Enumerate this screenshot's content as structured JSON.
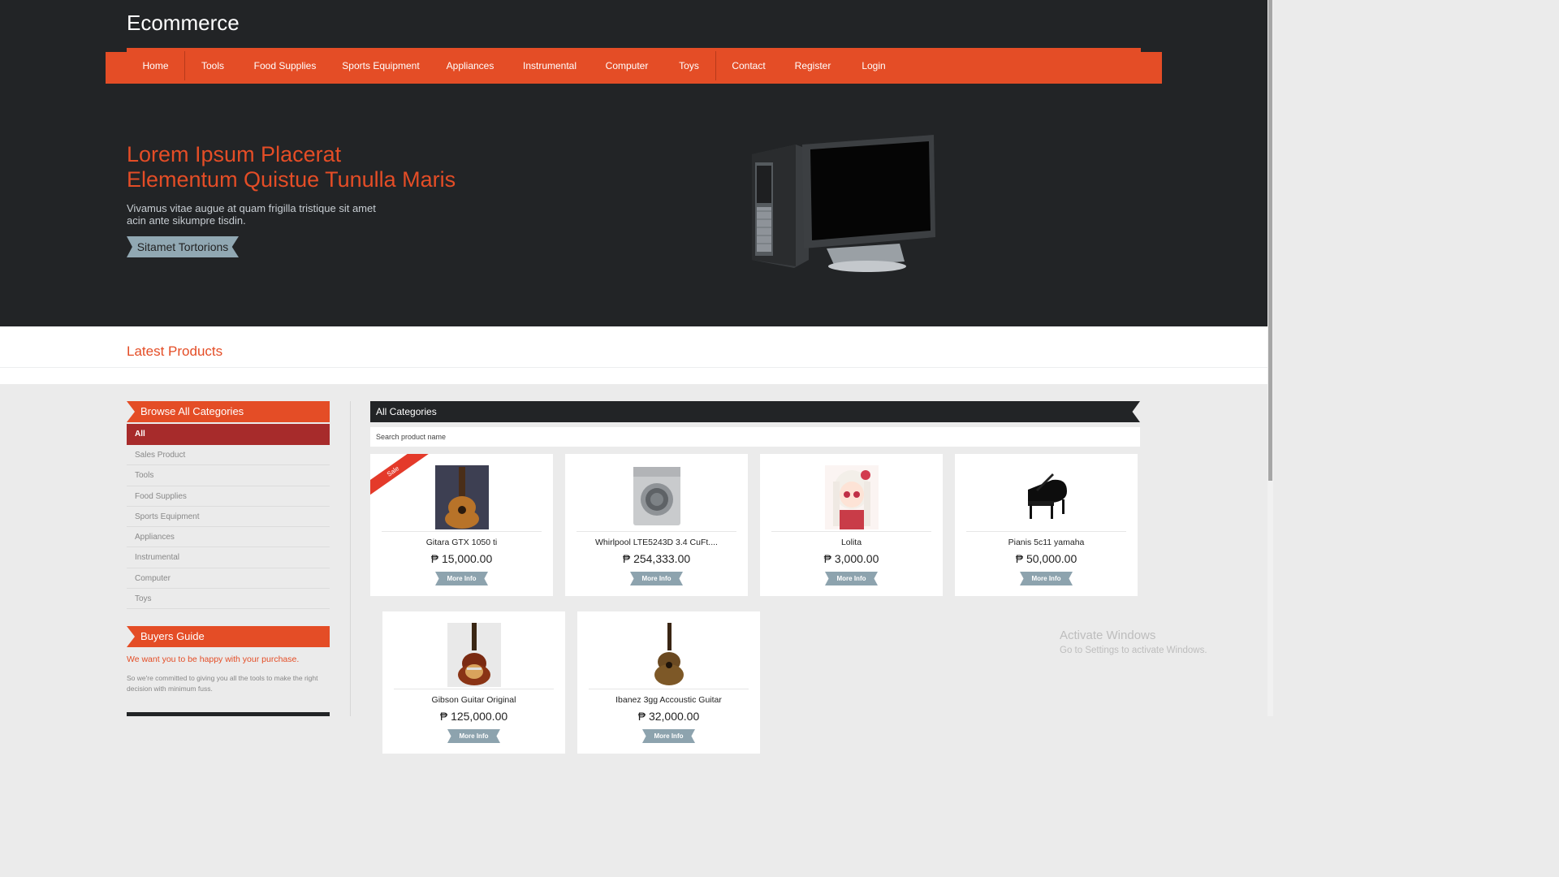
{
  "site": {
    "logo": "Ecommerce"
  },
  "nav": [
    {
      "label": "Home",
      "name": "nav-home",
      "sep": true
    },
    {
      "label": "Tools",
      "name": "nav-tools",
      "sep": false
    },
    {
      "label": "Food Supplies",
      "name": "nav-food-supplies",
      "sep": false
    },
    {
      "label": "Sports Equipment",
      "name": "nav-sports-equipment",
      "sep": false
    },
    {
      "label": "Appliances",
      "name": "nav-appliances",
      "sep": false
    },
    {
      "label": "Instrumental",
      "name": "nav-instrumental",
      "sep": false
    },
    {
      "label": "Computer",
      "name": "nav-computer",
      "sep": false
    },
    {
      "label": "Toys",
      "name": "nav-toys",
      "sep": true
    },
    {
      "label": "Contact",
      "name": "nav-contact",
      "sep": false
    },
    {
      "label": "Register",
      "name": "nav-register",
      "sep": false
    },
    {
      "label": "Login",
      "name": "nav-login",
      "sep": false
    }
  ],
  "hero": {
    "title_line1": "Lorem Ipsum Placerat",
    "title_line2": "Elementum Quistue Tunulla Maris",
    "subtitle_line1": "Vivamus vitae augue at quam frigilla tristique sit amet",
    "subtitle_line2": "acin ante sikumpre tisdin.",
    "cta": "Sitamet Tortorions"
  },
  "latest": {
    "title": "Latest Products"
  },
  "sidebar": {
    "categories_title": "Browse All Categories",
    "categories": [
      "All",
      "Sales Product",
      "Tools",
      "Food Supplies",
      "Sports Equipment",
      "Appliances",
      "Instrumental",
      "Computer",
      "Toys"
    ],
    "active": "All",
    "guide_title": "Buyers Guide",
    "guide_lead": "We want you to be happy with your purchase.",
    "guide_text": "So we're committed to giving you all the tools to make the right decision with minimum fuss."
  },
  "main": {
    "title": "All Categories",
    "search_placeholder": "Search product name",
    "more_info_label": "More Info",
    "sale_label": "Sale",
    "products": [
      {
        "name": "Gitara GTX 1050 ti",
        "price": "₱ 15,000.00",
        "sale": true,
        "image": "acoustic-guitar-photo"
      },
      {
        "name": "Whirlpool LTE5243D 3.4 CuFt....",
        "price": "₱ 254,333.00",
        "sale": false,
        "image": "washing-machine-photo"
      },
      {
        "name": "Lolita",
        "price": "₱ 3,000.00",
        "sale": false,
        "image": "anime-character-picture"
      },
      {
        "name": "Pianis 5c11 yamaha",
        "price": "₱ 50,000.00",
        "sale": false,
        "image": "grand-piano-photo"
      },
      {
        "name": "Gibson Guitar Original",
        "price": "₱ 125,000.00",
        "sale": false,
        "image": "electric-guitar-photo"
      },
      {
        "name": "Ibanez 3gg Accoustic Guitar",
        "price": "₱ 32,000.00",
        "sale": false,
        "image": "ibanez-guitar-photo"
      }
    ]
  },
  "watermark": {
    "line1": "Activate Windows",
    "line2": "Go to Settings to activate Windows."
  },
  "colors": {
    "accent": "#e44d26",
    "dark": "#222426",
    "active_category": "#a72b2b",
    "button": "#8da3ae"
  }
}
